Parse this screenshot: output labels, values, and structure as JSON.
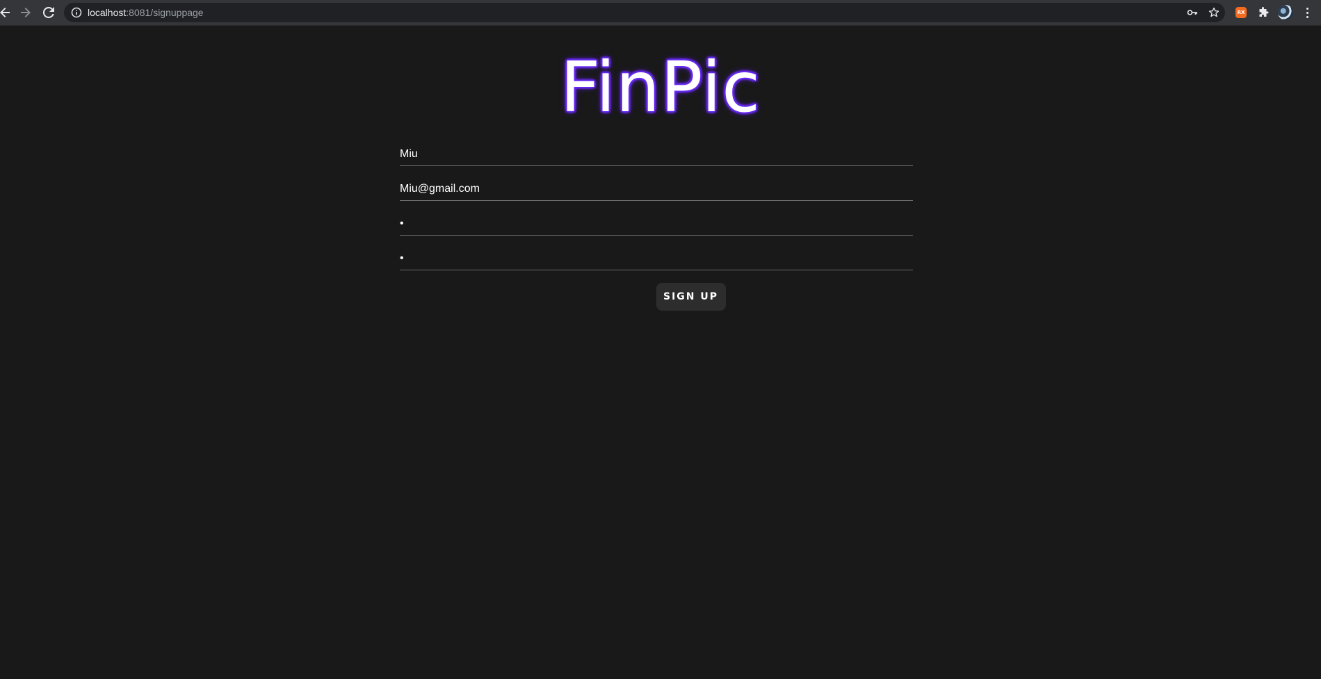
{
  "browser": {
    "url_host": "localhost",
    "url_rest": ":8081/signuppage",
    "extension_label": "RX",
    "icons": {
      "back": "arrow-left-icon",
      "forward": "arrow-right-icon",
      "reload": "reload-icon",
      "info": "info-icon",
      "password": "key-icon",
      "bookmark": "star-icon",
      "extensions": "puzzle-icon",
      "menu": "more-vert-icon"
    }
  },
  "page": {
    "logo": "FinPic",
    "logo_glow_color": "#6a2cff",
    "background_color": "#191919"
  },
  "form": {
    "name_value": "Miu",
    "email_value": "Miu@gmail.com",
    "password_value": "x",
    "confirm_password_value": "x",
    "submit_label": "Sign Up"
  }
}
